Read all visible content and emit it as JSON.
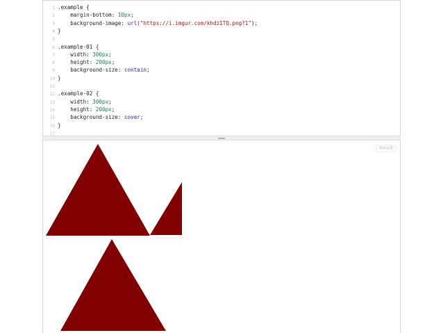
{
  "editor": {
    "lines": [
      {
        "num": "1",
        "parts": [
          {
            "t": ".example {",
            "c": ""
          }
        ]
      },
      {
        "num": "2",
        "parts": [
          {
            "t": "    margin-bottom: ",
            "c": ""
          },
          {
            "t": "10px",
            "c": "tok-val"
          },
          {
            "t": ";",
            "c": ""
          }
        ]
      },
      {
        "num": "3",
        "parts": [
          {
            "t": "    background-image: ",
            "c": ""
          },
          {
            "t": "url(",
            "c": "tok-kw"
          },
          {
            "t": "\"https://i.imgur.com/khdz1TQ.png?1\"",
            "c": "tok-str"
          },
          {
            "t": ");",
            "c": ""
          }
        ]
      },
      {
        "num": "4",
        "parts": [
          {
            "t": "}",
            "c": ""
          }
        ]
      },
      {
        "num": "5",
        "parts": [
          {
            "t": "",
            "c": ""
          }
        ]
      },
      {
        "num": "6",
        "parts": [
          {
            "t": ".example-01 {",
            "c": ""
          }
        ]
      },
      {
        "num": "7",
        "parts": [
          {
            "t": "    width: ",
            "c": ""
          },
          {
            "t": "300px",
            "c": "tok-val"
          },
          {
            "t": ";",
            "c": ""
          }
        ]
      },
      {
        "num": "8",
        "parts": [
          {
            "t": "    height: ",
            "c": ""
          },
          {
            "t": "200px",
            "c": "tok-val"
          },
          {
            "t": ";",
            "c": ""
          }
        ]
      },
      {
        "num": "9",
        "parts": [
          {
            "t": "    background-size: ",
            "c": ""
          },
          {
            "t": "contain",
            "c": "tok-kw"
          },
          {
            "t": ";",
            "c": ""
          }
        ]
      },
      {
        "num": "10",
        "parts": [
          {
            "t": "}",
            "c": ""
          }
        ]
      },
      {
        "num": "11",
        "parts": [
          {
            "t": "",
            "c": ""
          }
        ]
      },
      {
        "num": "12",
        "parts": [
          {
            "t": ".example-02 {",
            "c": ""
          }
        ]
      },
      {
        "num": "13",
        "parts": [
          {
            "t": "    width: ",
            "c": ""
          },
          {
            "t": "300px",
            "c": "tok-val"
          },
          {
            "t": ";",
            "c": ""
          }
        ]
      },
      {
        "num": "14",
        "parts": [
          {
            "t": "    height: ",
            "c": ""
          },
          {
            "t": "200px",
            "c": "tok-val"
          },
          {
            "t": ";",
            "c": ""
          }
        ]
      },
      {
        "num": "15",
        "parts": [
          {
            "t": "    background-size: ",
            "c": ""
          },
          {
            "t": "cover",
            "c": "tok-kw"
          },
          {
            "t": ";",
            "c": ""
          }
        ]
      },
      {
        "num": "16",
        "parts": [
          {
            "t": "}",
            "c": ""
          }
        ]
      },
      {
        "num": "17",
        "parts": [
          {
            "t": "",
            "c": ""
          }
        ]
      }
    ]
  },
  "result": {
    "label": "Result",
    "shape_color": "#800000"
  }
}
